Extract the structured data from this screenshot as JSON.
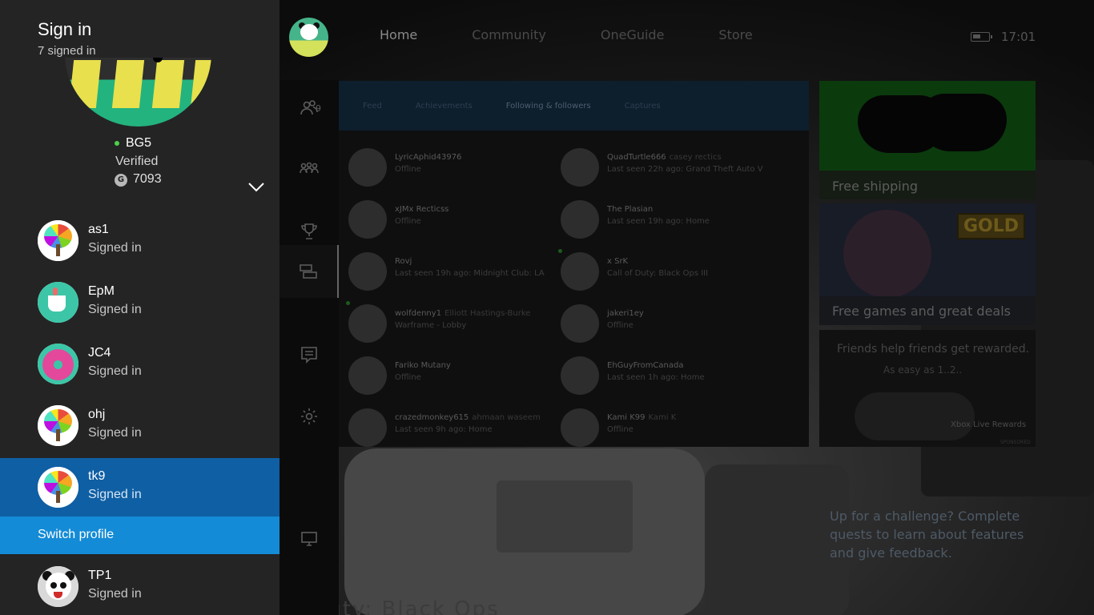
{
  "signin": {
    "title": "Sign in",
    "count": "7 signed in",
    "current": {
      "gamertag": "BG5",
      "verified": "Verified",
      "gamerscore_icon": "G",
      "gamerscore": "7093"
    },
    "profiles": [
      {
        "name": "as1",
        "status": "Signed in"
      },
      {
        "name": "EpM",
        "status": "Signed in"
      },
      {
        "name": "JC4",
        "status": "Signed in"
      },
      {
        "name": "ohj",
        "status": "Signed in"
      },
      {
        "name": "tk9",
        "status": "Signed in"
      },
      {
        "name": "TP1",
        "status": "Signed in"
      }
    ],
    "switch_profile": "Switch profile"
  },
  "nav": {
    "tabs": [
      "Home",
      "Community",
      "OneGuide",
      "Store"
    ],
    "active": "Home",
    "time": "17:01"
  },
  "rail": {
    "friends_count": "9"
  },
  "friends": {
    "tabs": [
      "Feed",
      "Achievements",
      "Following & followers",
      "Captures"
    ],
    "active_tab": "Following & followers",
    "list": [
      {
        "name": "LyricAphid43976",
        "real": "",
        "status": "Offline"
      },
      {
        "name": "QuadTurtle666",
        "real": "casey rectics",
        "status": "Last seen 22h ago: Grand Theft Auto V"
      },
      {
        "name": "xJMx Recticss",
        "real": "",
        "status": "Offline"
      },
      {
        "name": "The Plasian",
        "real": "",
        "status": "Last seen 19h ago: Home"
      },
      {
        "name": "Rovj",
        "real": "",
        "status": "Last seen 19h ago: Midnight Club: LA"
      },
      {
        "name": "x SrK",
        "real": "",
        "status": "Call of Duty: Black Ops III"
      },
      {
        "name": "wolfdenny1",
        "real": "Elliott Hastings-Burke",
        "status": "Warframe - Lobby"
      },
      {
        "name": "jakeri1ey",
        "real": "",
        "status": "Offline"
      },
      {
        "name": "Fariko Mutany",
        "real": "",
        "status": "Offline"
      },
      {
        "name": "EhGuyFromCanada",
        "real": "",
        "status": "Last seen 1h ago: Home"
      },
      {
        "name": "crazedmonkey615",
        "real": "ahmaan waseem",
        "status": "Last seen 9h ago: Home"
      },
      {
        "name": "Kami K99",
        "real": "Kami K",
        "status": "Offline"
      }
    ]
  },
  "ads": {
    "shipping": "Free shipping",
    "gold_badge": "GOLD",
    "games": "Free games and great deals",
    "rewards_line1": "Friends help friends get rewarded.",
    "rewards_line2": "As easy as 1..2..",
    "rewards_brand": "Xbox Live Rewards",
    "sponsored": "SPONSORED"
  },
  "challenge": "Up for a challenge? Complete quests to learn about features and give feedback.",
  "colors": {
    "selected_row": "#0f5fa4",
    "switch_profile": "#148bd6",
    "panel": "#242424",
    "presence": "#4cd04c"
  }
}
